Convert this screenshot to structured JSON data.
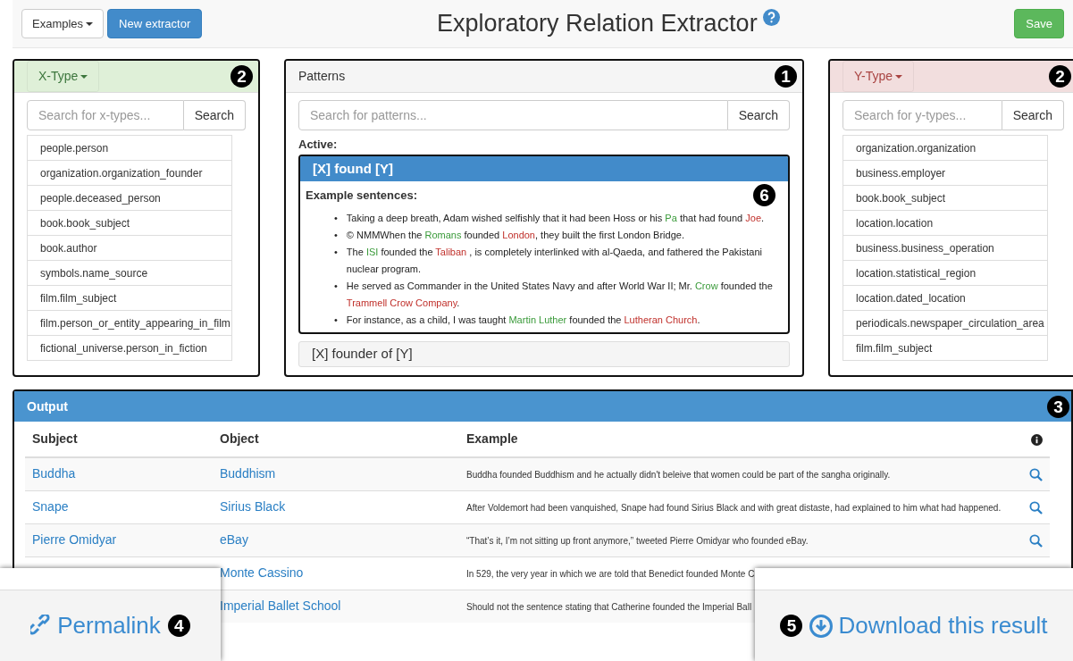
{
  "header": {
    "examples_button": "Examples",
    "new_button": "New extractor",
    "title": "Exploratory Relation Extractor",
    "save_button": "Save"
  },
  "x_panel": {
    "dropdown": "X-Type",
    "badge": "2",
    "placeholder": "Search for x-types...",
    "search_button": "Search",
    "items": [
      "people.person",
      "organization.organization_founder",
      "people.deceased_person",
      "book.book_subject",
      "book.author",
      "symbols.name_source",
      "film.film_subject",
      "film.person_or_entity_appearing_in_film",
      "fictional_universe.person_in_fiction"
    ]
  },
  "patterns_panel": {
    "title": "Patterns",
    "badge": "1",
    "placeholder": "Search for patterns...",
    "search_button": "Search",
    "active_label": "Active:",
    "patterns": [
      {
        "label": "[X] found [Y]",
        "active": true,
        "badge": "6",
        "example_heading": "Example sentences:",
        "sentences": [
          {
            "marker": "•",
            "segments": [
              {
                "text": "Taking a deep breath, Adam wished selfishly that it had been Hoss or his "
              },
              {
                "text": "Pa",
                "color": "#3a9a3a"
              },
              {
                "text": " that had found "
              },
              {
                "text": "Joe",
                "color": "#c0302b"
              },
              {
                "text": "."
              }
            ]
          },
          {
            "marker": "•",
            "segments": [
              {
                "text": "© NMMWhen the "
              },
              {
                "text": "Romans",
                "color": "#3a9a3a"
              },
              {
                "text": " founded "
              },
              {
                "text": "London",
                "color": "#c0302b"
              },
              {
                "text": ", they built the first London Bridge."
              }
            ]
          },
          {
            "marker": "•",
            "segments": [
              {
                "text": "The "
              },
              {
                "text": "ISI",
                "color": "#3a9a3a"
              },
              {
                "text": " founded the "
              },
              {
                "text": "Taliban",
                "color": "#c0302b"
              },
              {
                "text": " , is completely interlinked with al-Qaeda, and fathered the Pakistani nuclear program."
              }
            ]
          },
          {
            "marker": "•",
            "segments": [
              {
                "text": "He served as Commander in the United States Navy and after World War II; Mr. "
              },
              {
                "text": "Crow",
                "color": "#3a9a3a"
              },
              {
                "text": " founded the "
              },
              {
                "text": "Trammell Crow Company",
                "color": "#c0302b"
              },
              {
                "text": "."
              }
            ]
          },
          {
            "marker": "•",
            "segments": [
              {
                "text": "For instance, as a child, I was taught "
              },
              {
                "text": "Martin Luther",
                "color": "#3a9a3a"
              },
              {
                "text": " founded the "
              },
              {
                "text": "Lutheran Church",
                "color": "#c0302b"
              },
              {
                "text": "."
              }
            ]
          }
        ]
      },
      {
        "label": "[X] founder of [Y]",
        "active": false
      }
    ]
  },
  "y_panel": {
    "dropdown": "Y-Type",
    "badge": "2",
    "placeholder": "Search for y-types...",
    "search_button": "Search",
    "items": [
      "organization.organization",
      "business.employer",
      "book.book_subject",
      "location.location",
      "business.business_operation",
      "location.statistical_region",
      "location.dated_location",
      "periodicals.newspaper_circulation_area",
      "film.film_subject"
    ]
  },
  "output": {
    "title": "Output",
    "badge": "3",
    "columns": [
      "Subject",
      "Object",
      "Example"
    ],
    "rows": [
      {
        "subject": "Buddha",
        "object": "Buddhism",
        "example": "Buddha founded Buddhism and he actually didn't beleive that women could be part of the sangha originally.",
        "lookup": true
      },
      {
        "subject": "Snape",
        "object": "Sirius Black",
        "example": "After Voldemort had been vanquished, Snape had found Sirius Black and with great distaste, had explained to him what had happened.",
        "lookup": true
      },
      {
        "subject": "Pierre Omidyar",
        "object": "eBay",
        "example": "“That’s it, I’m not sitting up front anymore,” tweeted Pierre Omidyar who founded eBay.",
        "lookup": true
      },
      {
        "object": "Monte Cassino",
        "example": "In 529, the very year in which we are told that Benedict founded Monte C",
        "lookup": false
      },
      {
        "object": "Imperial Ballet School",
        "example": "Should not the sentence stating that Catherine founded the Imperial Ball",
        "lookup": false
      }
    ]
  },
  "permalink": {
    "label": "Permalink",
    "badge": "4"
  },
  "download": {
    "label": "Download this result",
    "badge": "5"
  }
}
